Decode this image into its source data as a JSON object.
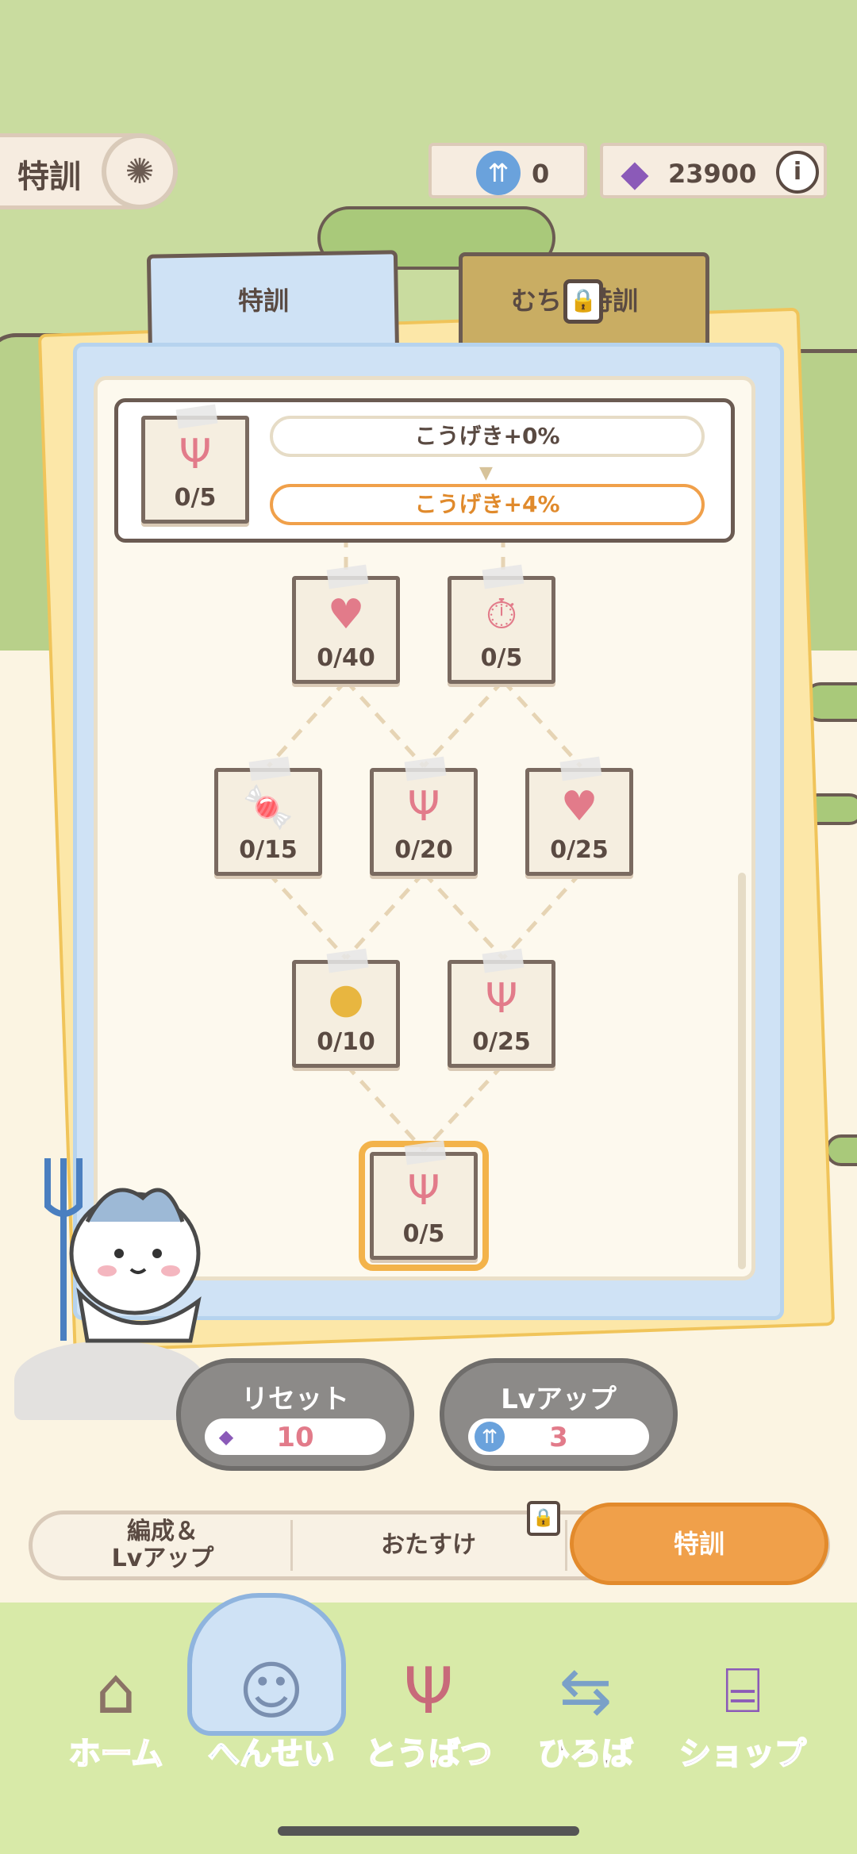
{
  "header": {
    "title": "特訓",
    "hint_icon": "lightbulb-icon",
    "currency_upgrade": {
      "icon": "blue-upgrade-coin-icon",
      "value": "0"
    },
    "currency_gem": {
      "icon": "purple-gem-icon",
      "value": "23900"
    },
    "info_label": "i"
  },
  "tabs": [
    {
      "label": "特訓",
      "active": true
    },
    {
      "label": "むちゃ特訓",
      "locked": true
    }
  ],
  "detail": {
    "node_count": "0/5",
    "node_icon": "pitchfork-icon",
    "current_stat": "こうげき+0%",
    "next_stat": "こうげき+4%"
  },
  "nodes": [
    {
      "icon": "heart-face-icon",
      "count": "0/40"
    },
    {
      "icon": "stopwatch-up-icon",
      "count": "0/5"
    },
    {
      "icon": "candy-up-icon",
      "count": "0/15"
    },
    {
      "icon": "pitchfork-icon",
      "count": "0/20"
    },
    {
      "icon": "heart-face-icon",
      "count": "0/25"
    },
    {
      "icon": "coins-up-icon",
      "count": "0/10"
    },
    {
      "icon": "pitchfork-icon",
      "count": "0/25"
    },
    {
      "icon": "pitchfork-icon",
      "count": "0/5",
      "selected": true
    }
  ],
  "actions": {
    "reset": {
      "label": "リセット",
      "cost_icon": "purple-gem-icon",
      "cost": "10"
    },
    "lvup": {
      "label": "Lvアップ",
      "cost_icon": "blue-upgrade-coin-icon",
      "cost": "3"
    }
  },
  "segments": {
    "formation": "編成＆\nLvアップ",
    "otasuke": "おたすけ",
    "tokkun": "特訓"
  },
  "nav": {
    "home": "ホーム",
    "hensei": "へんせい",
    "toubatsu": "とうばつ",
    "hiroba": "ひろば",
    "shop": "ショップ"
  },
  "colors": {
    "accent_orange": "#f0a04a",
    "panel_blue": "#cfe2f5",
    "panel_yellow": "#fce7a8",
    "count_pink": "#e27b8a"
  }
}
